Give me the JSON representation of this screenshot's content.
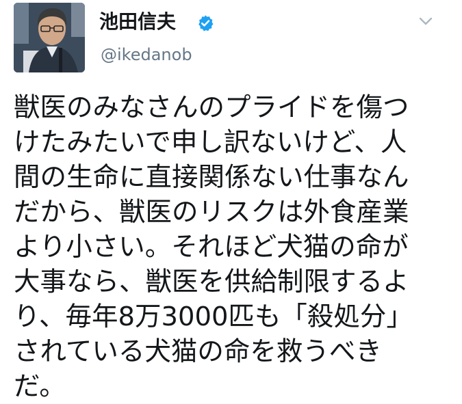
{
  "author": {
    "display_name": "池田信夫",
    "handle": "@ikedanob",
    "verified": true
  },
  "icons": {
    "verified": "verified-badge-icon",
    "more": "chevron-down-icon"
  },
  "colors": {
    "verified_blue": "#1da1f2",
    "handle_gray": "#657786",
    "chevron_gray": "#aab8c2",
    "text": "#14171a"
  },
  "tweet": {
    "lines": [
      "獣医のみなさんのプライドを傷つ",
      "けたみたいで申し訳ないけど、人",
      "間の生命に直接関係ない仕事なん",
      "だから、獣医のリスクは外食産業",
      "より小さい。それほど犬猫の命が",
      "大事なら、獣医を供給制限するよ",
      "り、毎年8万3000匹も「殺処分」",
      "されている犬猫の命を救うべき",
      "だ。"
    ]
  }
}
